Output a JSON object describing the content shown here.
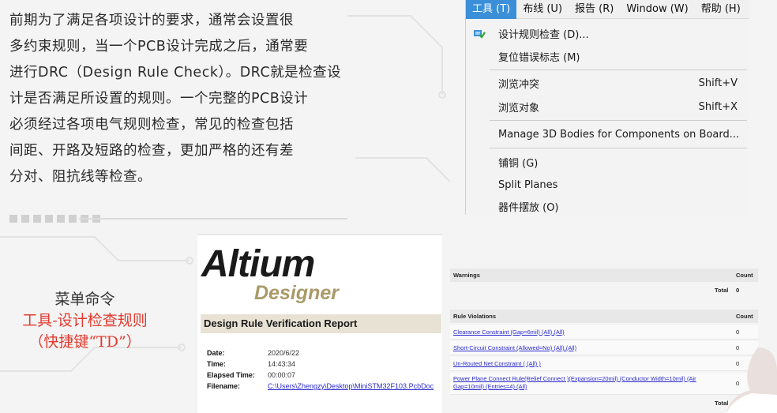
{
  "intro": {
    "lines": [
      "前期为了满足各项设计的要求，通常会设置很",
      "多约束规则，当一个PCB设计完成之后，通常要",
      "进行DRC（Design Rule Check）。DRC就是检查设",
      "计是否满足所设置的规则。一个完整的PCB设计",
      "必须经过各项电气规则检查，常见的检查包括",
      "间距、开路及短路的检查，更加严格的还有差",
      "分对、阻抗线等检查。"
    ]
  },
  "menu": {
    "menubar": [
      {
        "label": "工具 (T)",
        "active": true
      },
      {
        "label": "布线 (U)",
        "active": false
      },
      {
        "label": "报告 (R)",
        "active": false
      },
      {
        "label": "Window (W)",
        "active": false
      },
      {
        "label": "帮助 (H)",
        "active": false
      }
    ],
    "items": [
      {
        "label": "设计规则检查 (D)...",
        "shortcut": "",
        "icon": "design-rule-check-icon"
      },
      {
        "label": "复位错误标志 (M)",
        "shortcut": ""
      },
      {
        "label": "浏览冲突",
        "shortcut": "Shift+V"
      },
      {
        "label": "浏览对象",
        "shortcut": "Shift+X"
      },
      {
        "label": "Manage 3D Bodies for Components on Board...",
        "shortcut": ""
      },
      {
        "label": "铺铜 (G)",
        "shortcut": ""
      },
      {
        "label": "Split Planes",
        "shortcut": ""
      },
      {
        "label": "器件摆放 (O)",
        "shortcut": ""
      }
    ]
  },
  "caption": {
    "line1": "菜单命令",
    "line2": "工具-设计检查规则",
    "line3": "（快捷键“TD”）"
  },
  "report": {
    "logo_altium": "Altium",
    "logo_designer": "Designer",
    "title": "Design Rule Verification Report",
    "meta": [
      {
        "label": "Date:",
        "value": "2020/6/22"
      },
      {
        "label": "Time:",
        "value": "14:43:34"
      },
      {
        "label": "Elapsed Time:",
        "value": "00:00:07"
      },
      {
        "label": "Filename:",
        "value": "C:\\Users\\Zhengzy\\Desktop\\MiniSTM32F103.PcbDoc"
      }
    ]
  },
  "warnings_table": {
    "header": "Warnings",
    "count_header": "Count",
    "total_label": "Total",
    "total_value": "0"
  },
  "violations_table": {
    "header": "Rule Violations",
    "count_header": "Count",
    "rows": [
      {
        "rule": "Clearance Constraint (Gap=6mil) (All),(All)",
        "count": "0"
      },
      {
        "rule": "Short-Circuit Constraint (Allowed=No) (All),(All)",
        "count": "0"
      },
      {
        "rule": "Un-Routed Net Constraint ( (All) )",
        "count": "0"
      },
      {
        "rule": "Power Plane Connect Rule(Relief Connect )(Expansion=20mil) (Conductor Width=10mil) (Air Gap=10mil) (Entries=4) (All)",
        "count": "0"
      }
    ],
    "total_label": "Total"
  },
  "colors": {
    "menu_active": "#3a8fd8",
    "caption_red": "#e23a2e",
    "link_blue": "#2a2ad0",
    "logo_gold": "#a99a68"
  }
}
